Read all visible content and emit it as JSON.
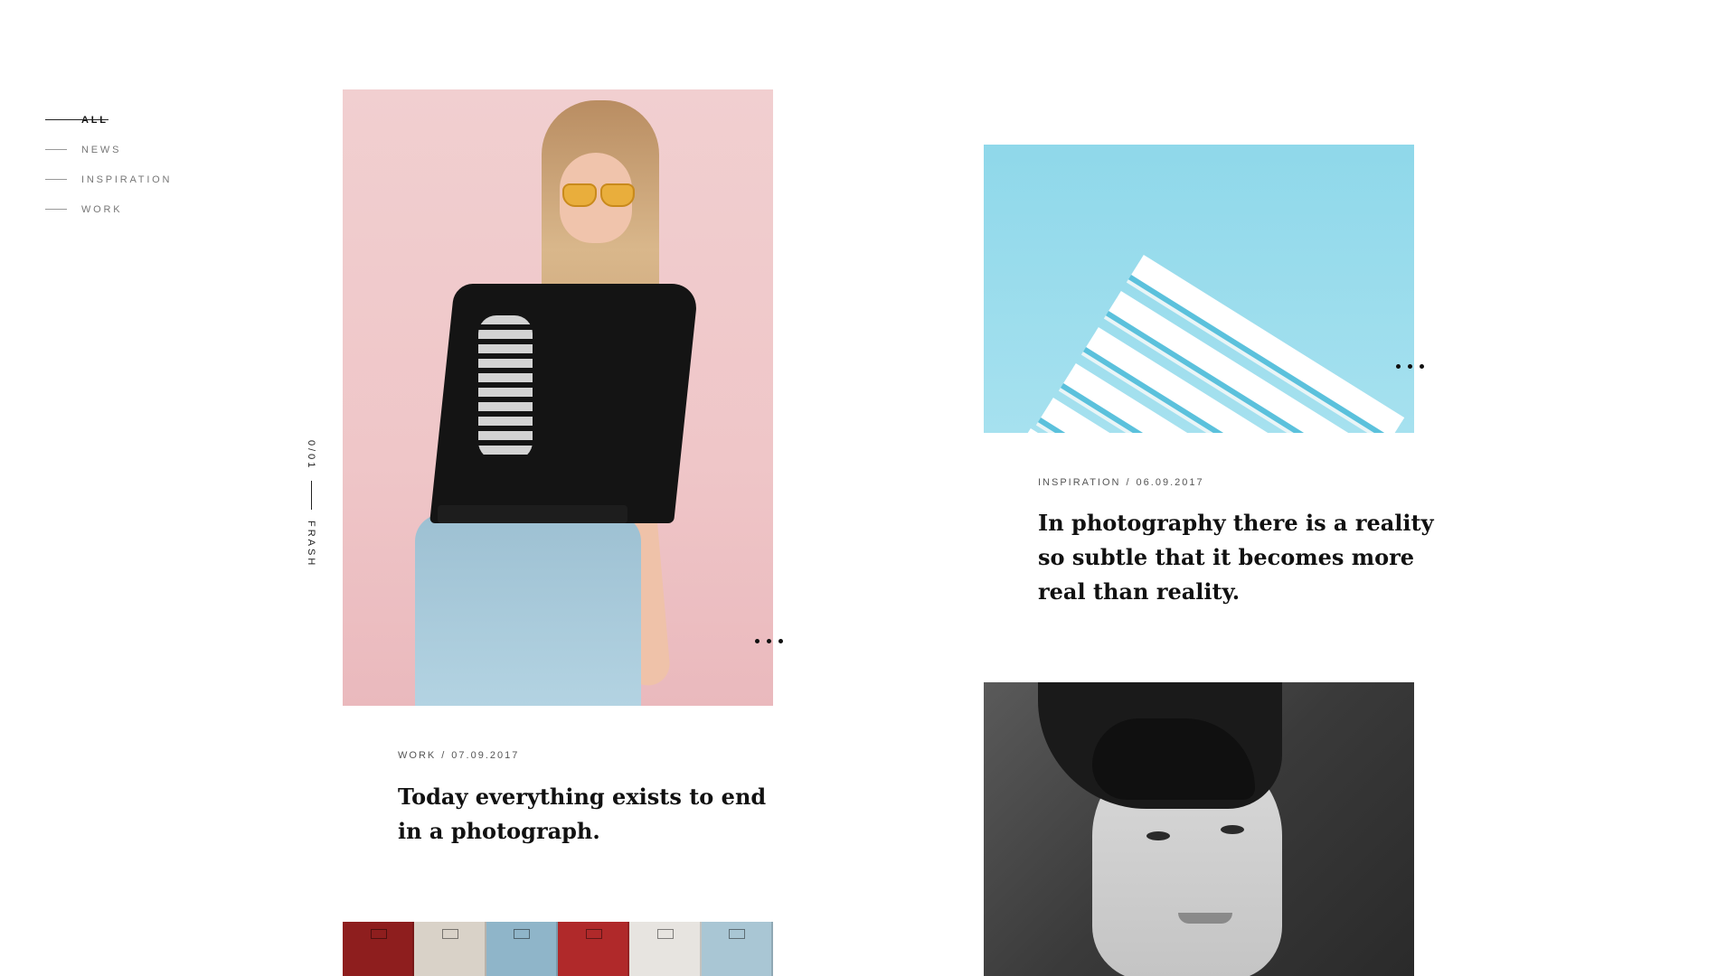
{
  "filters": [
    {
      "label": "All",
      "active": true
    },
    {
      "label": "News",
      "active": false
    },
    {
      "label": "Inspiration",
      "active": false
    },
    {
      "label": "Work",
      "active": false
    }
  ],
  "side_counter": {
    "index": "0/01",
    "label": "FRASH"
  },
  "cards": [
    {
      "category": "Work",
      "date": "07.09.2017",
      "title_line1": "Today everything exists to end",
      "title_line2": "in a photograph."
    },
    {
      "category": "Inspiration",
      "date": "06.09.2017",
      "title_line1": "In photography there is a reality",
      "title_line2": "so subtle that it becomes more",
      "title_line3": "real than reality."
    }
  ],
  "images": {
    "card1": "woman-pink-wall-photo",
    "card2": "blue-building-photo",
    "card3": "man-portrait-bw-photo",
    "card4": "colored-lockers-photo"
  },
  "colors": {
    "accent": "#111111",
    "pink_bg": "#efc6c8",
    "sky": "#8fd8ea",
    "lockers": [
      "#8e1e1e",
      "#d9d2c8",
      "#8fb5c9",
      "#b0292a",
      "#e7e4e0",
      "#a9c6d4"
    ]
  }
}
